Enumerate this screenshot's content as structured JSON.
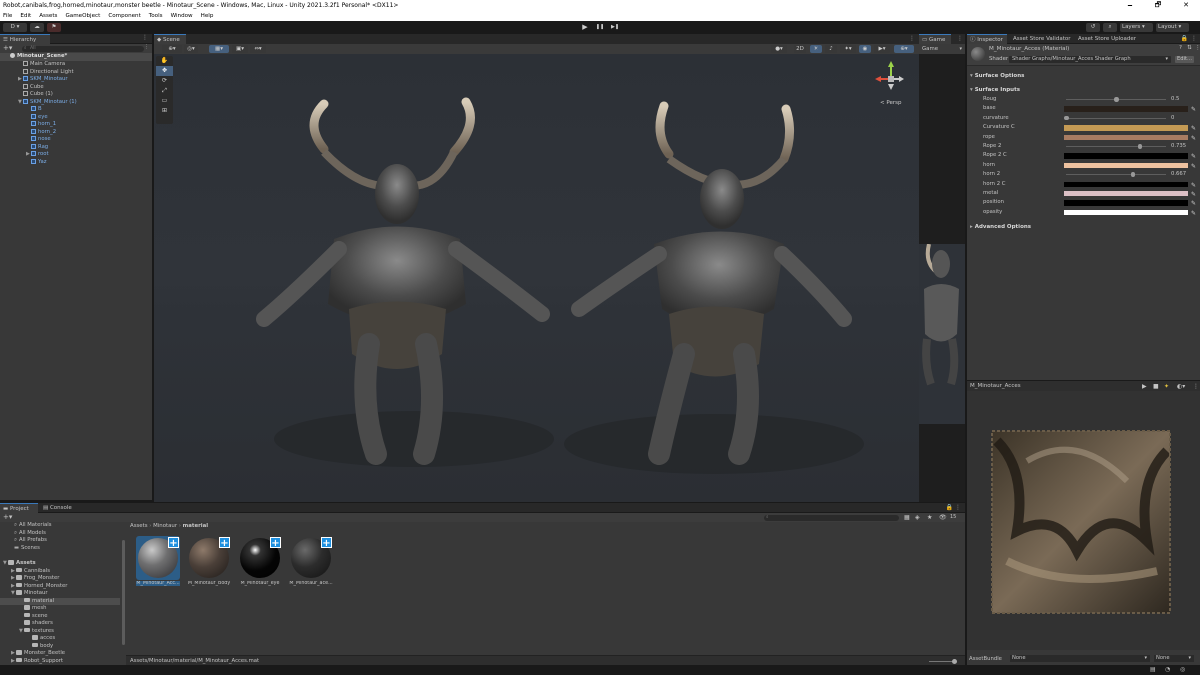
{
  "window": {
    "title": "Robot,canibals,frog,horned,minotaur,monster beetle - Minotaur_Scene - Windows, Mac, Linux - Unity 2021.3.2f1 Personal* <DX11>",
    "minimize": "🗕",
    "maximize": "🗗",
    "close": "✕"
  },
  "menu": [
    "File",
    "Edit",
    "Assets",
    "GameObject",
    "Component",
    "Tools",
    "Window",
    "Help"
  ],
  "toolbar": {
    "account": "D ▾",
    "layers": "Layers",
    "layout": "Layout",
    "play": "▶",
    "pause": "❚❚",
    "step": "▶❚"
  },
  "hierarchy": {
    "tab": "Hierarchy",
    "search_placeholder": "All",
    "scene": "Minotaur_Scene*",
    "items": [
      {
        "label": "Main Camera",
        "blue": false,
        "indent": 1,
        "arrow": ""
      },
      {
        "label": "Directional Light",
        "blue": false,
        "indent": 1,
        "arrow": ""
      },
      {
        "label": "SKM_Minotaur",
        "blue": true,
        "indent": 1,
        "arrow": "▶"
      },
      {
        "label": "Cube",
        "blue": false,
        "indent": 1,
        "arrow": ""
      },
      {
        "label": "Cube (1)",
        "blue": false,
        "indent": 1,
        "arrow": ""
      },
      {
        "label": "SKM_Minotaur (1)",
        "blue": true,
        "indent": 1,
        "arrow": "▼"
      },
      {
        "label": "B",
        "blue": true,
        "indent": 2,
        "arrow": ""
      },
      {
        "label": "eye",
        "blue": true,
        "indent": 2,
        "arrow": ""
      },
      {
        "label": "horn_1",
        "blue": true,
        "indent": 2,
        "arrow": ""
      },
      {
        "label": "horn_2",
        "blue": true,
        "indent": 2,
        "arrow": ""
      },
      {
        "label": "nose",
        "blue": true,
        "indent": 2,
        "arrow": ""
      },
      {
        "label": "Rag",
        "blue": true,
        "indent": 2,
        "arrow": ""
      },
      {
        "label": "root",
        "blue": true,
        "indent": 2,
        "arrow": "▶"
      },
      {
        "label": "Yaz",
        "blue": true,
        "indent": 2,
        "arrow": ""
      }
    ]
  },
  "scene": {
    "tab": "Scene",
    "persp": "< Persp",
    "shading_label": "2D"
  },
  "game": {
    "tab": "Game",
    "display": "Game"
  },
  "project": {
    "tab": "Project",
    "console_tab": "Console",
    "favorites": [
      "All Materials",
      "All Models",
      "All Prefabs",
      "Scenes"
    ],
    "tree": [
      {
        "label": "Assets",
        "indent": 0,
        "bold": true,
        "arrow": "▼",
        "sel": false
      },
      {
        "label": "Cannibals",
        "indent": 1,
        "bold": false,
        "arrow": "▶",
        "sel": false
      },
      {
        "label": "Frog_Monster",
        "indent": 1,
        "bold": false,
        "arrow": "▶",
        "sel": false
      },
      {
        "label": "Horned_Monster",
        "indent": 1,
        "bold": false,
        "arrow": "▶",
        "sel": false
      },
      {
        "label": "Minotaur",
        "indent": 1,
        "bold": false,
        "arrow": "▼",
        "sel": false
      },
      {
        "label": "material",
        "indent": 2,
        "bold": false,
        "arrow": "",
        "sel": true
      },
      {
        "label": "mesh",
        "indent": 2,
        "bold": false,
        "arrow": "",
        "sel": false
      },
      {
        "label": "scene",
        "indent": 2,
        "bold": false,
        "arrow": "",
        "sel": false
      },
      {
        "label": "shaders",
        "indent": 2,
        "bold": false,
        "arrow": "",
        "sel": false
      },
      {
        "label": "textures",
        "indent": 2,
        "bold": false,
        "arrow": "▼",
        "sel": false
      },
      {
        "label": "acces",
        "indent": 3,
        "bold": false,
        "arrow": "",
        "sel": false
      },
      {
        "label": "body",
        "indent": 3,
        "bold": false,
        "arrow": "",
        "sel": false
      },
      {
        "label": "Monster_Beetle",
        "indent": 1,
        "bold": false,
        "arrow": "▶",
        "sel": false
      },
      {
        "label": "Robot_Support",
        "indent": 1,
        "bold": false,
        "arrow": "▶",
        "sel": false
      }
    ],
    "breadcrumb": [
      "Assets",
      "Minotaur",
      "material"
    ],
    "assets": [
      {
        "label": "M_Minotaur_Acc...",
        "style": "acces"
      },
      {
        "label": "M_Minotaur_Body",
        "style": "body"
      },
      {
        "label": "M_Minotaur_eye",
        "style": "eye"
      },
      {
        "label": "M_Minotaur_ace...",
        "style": "dark"
      }
    ],
    "status_path": "Assets/Minotaur/material/M_Minotaur_Acces.mat",
    "badge_count": "15"
  },
  "inspector": {
    "tabs": [
      "Inspector",
      "Asset Store Validator",
      "Asset Store Uploader"
    ],
    "material_name": "M_Minotaur_Acces (Material)",
    "shader_label": "Shader",
    "shader_value": "Shader Graphs/Minotaur_Acces Shader Graph",
    "edit_button": "Edit...",
    "surface_options": "Surface Options",
    "surface_inputs": "Surface Inputs",
    "advanced_options": "Advanced Options",
    "properties": [
      {
        "name": "Roug",
        "type": "slider",
        "value": "0.5",
        "fraction": 0.5
      },
      {
        "name": "base",
        "type": "color",
        "color": "#28201a"
      },
      {
        "name": "curvature",
        "type": "slider",
        "value": "0",
        "fraction": 0.0
      },
      {
        "name": "Curvature C",
        "type": "color",
        "color": "#c49a54"
      },
      {
        "name": "rope",
        "type": "color",
        "color": "#a87c62"
      },
      {
        "name": "Rope 2",
        "type": "slider",
        "value": "0.735",
        "fraction": 0.735
      },
      {
        "name": "Rope 2 C",
        "type": "color",
        "color": "#000000"
      },
      {
        "name": "horn",
        "type": "color",
        "color": "#eec2a0"
      },
      {
        "name": "horn 2",
        "type": "slider",
        "value": "0.667",
        "fraction": 0.667
      },
      {
        "name": "horn 2 C",
        "type": "color",
        "color": "#000000"
      },
      {
        "name": "metal",
        "type": "color",
        "color": "#dcc0c6"
      },
      {
        "name": "position",
        "type": "color",
        "color": "#000000"
      },
      {
        "name": "opasity",
        "type": "color",
        "color": "#ffffff"
      }
    ],
    "preview_title": "M_Minotaur_Acces",
    "assetbundle_label": "AssetBundle",
    "assetbundle_value": "None",
    "assetbundle_variant": "None"
  },
  "colors": {
    "accent": "#3a79bb",
    "selection": "#2c5d87",
    "link_blue": "#7caee8"
  }
}
